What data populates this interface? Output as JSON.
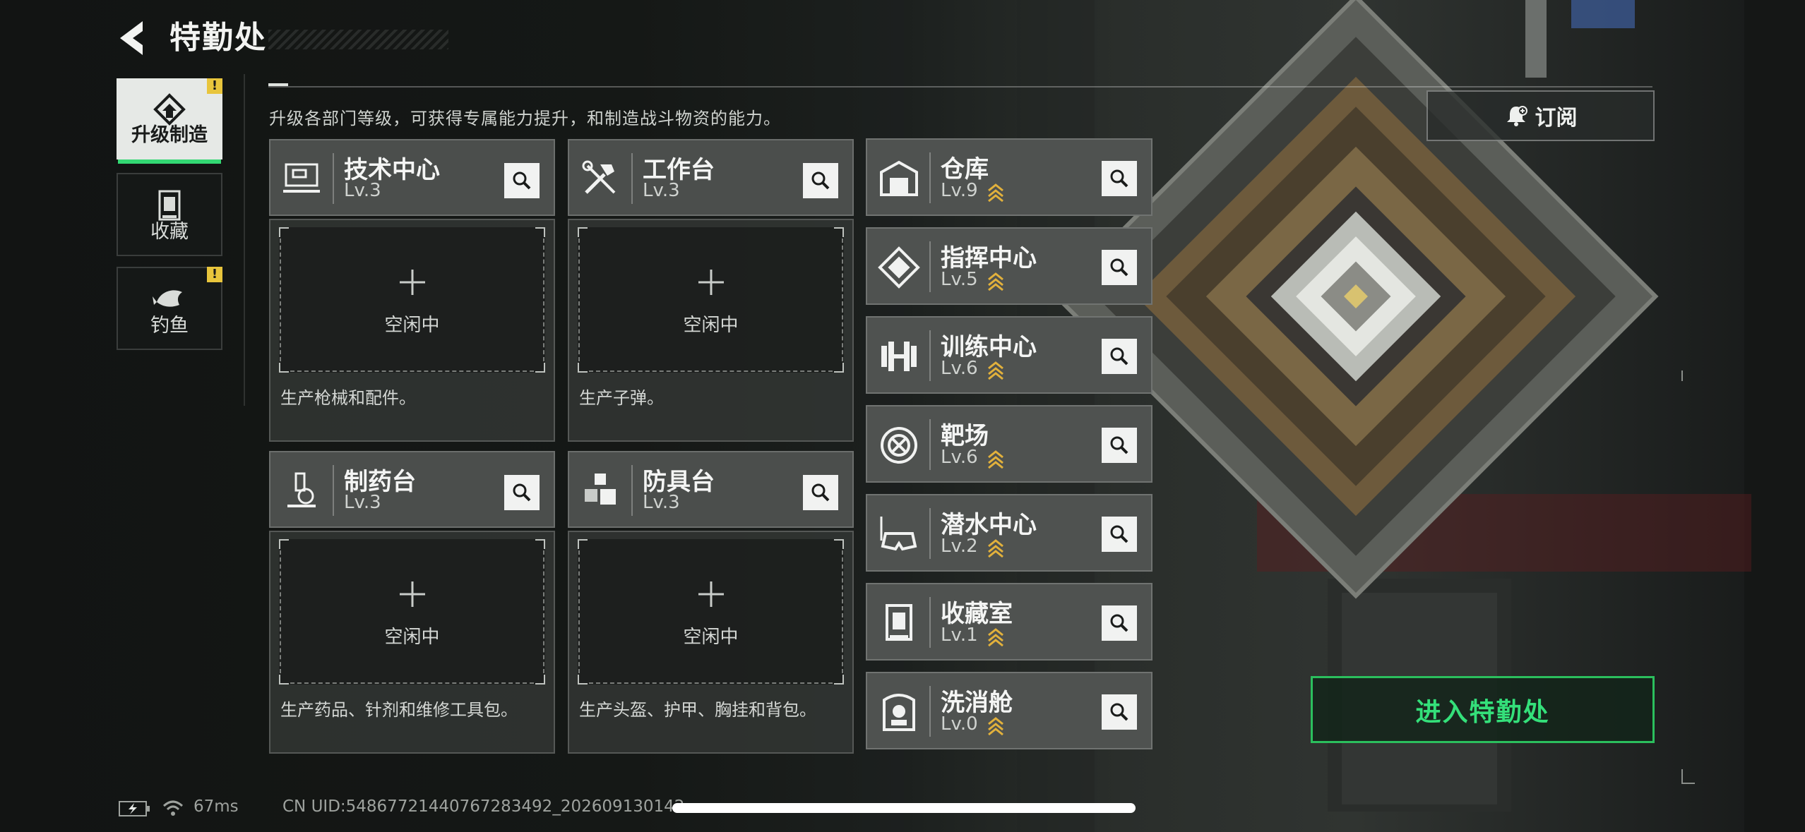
{
  "header": {
    "title": "特勤处"
  },
  "sidebar": {
    "tabs": [
      {
        "label": "升级制造",
        "active": true,
        "alert": "!"
      },
      {
        "label": "收藏",
        "active": false
      },
      {
        "label": "钓鱼",
        "active": false,
        "alert": "!"
      }
    ]
  },
  "intro": "升级各部门等级，可获得专属能力提升，和制造战斗物资的能力。",
  "subscribe": {
    "label": "订阅",
    "icon": "bell-icon"
  },
  "workshops": [
    {
      "name": "技术中心",
      "level": "Lv.3",
      "status": "空闲中",
      "desc": "生产枪械和配件。",
      "icon": "computer-icon"
    },
    {
      "name": "工作台",
      "level": "Lv.3",
      "status": "空闲中",
      "desc": "生产子弹。",
      "icon": "tools-icon"
    },
    {
      "name": "制药台",
      "level": "Lv.3",
      "status": "空闲中",
      "desc": "生产药品、针剂和维修工具包。",
      "icon": "microscope-icon"
    },
    {
      "name": "防具台",
      "level": "Lv.3",
      "status": "空闲中",
      "desc": "生产头盔、护甲、胸挂和背包。",
      "icon": "armor-cubes-icon"
    }
  ],
  "departments": [
    {
      "name": "仓库",
      "level": "Lv.9",
      "icon": "warehouse-icon"
    },
    {
      "name": "指挥中心",
      "level": "Lv.5",
      "icon": "command-chip-icon"
    },
    {
      "name": "训练中心",
      "level": "Lv.6",
      "icon": "dumbbell-icon"
    },
    {
      "name": "靶场",
      "level": "Lv.6",
      "icon": "target-icon"
    },
    {
      "name": "潜水中心",
      "level": "Lv.2",
      "icon": "diving-mask-icon"
    },
    {
      "name": "收藏室",
      "level": "Lv.1",
      "icon": "collection-case-icon"
    },
    {
      "name": "洗消舱",
      "level": "Lv.0",
      "icon": "decon-chamber-icon"
    }
  ],
  "enter_button": {
    "label": "进入特勤处"
  },
  "status_bar": {
    "ping": "67ms",
    "uid": "CN UID:5486772144076728349​2_202609130142"
  },
  "colors": {
    "accent_green": "#34e07a",
    "alert_yellow": "#e8c53c",
    "upgrade_gold": "#e2b13c",
    "card_header": "#4b4e4c"
  }
}
